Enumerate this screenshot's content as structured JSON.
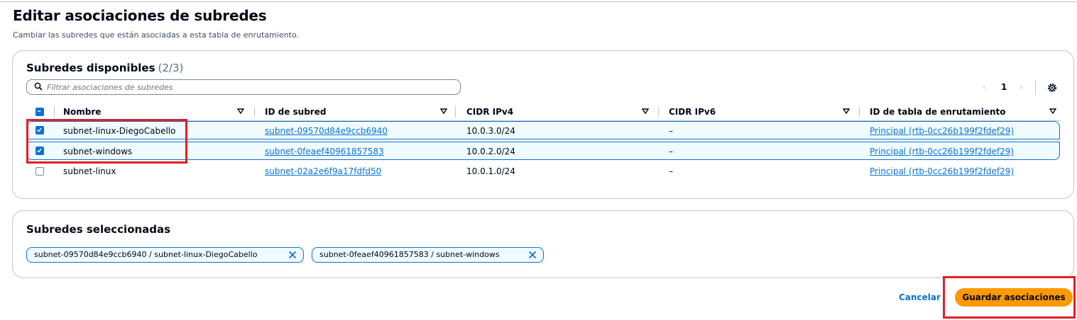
{
  "page": {
    "title": "Editar asociaciones de subredes",
    "description": "Cambiar las subredes que están asociadas a esta tabla de enrutamiento."
  },
  "available": {
    "title": "Subredes disponibles",
    "count": "(2/3)",
    "filter_placeholder": "Filtrar asociaciones de subredes",
    "page_number": "1",
    "columns": [
      "Nombre",
      "ID de subred",
      "CIDR IPv4",
      "CIDR IPv6",
      "ID de tabla de enrutamiento"
    ],
    "rows": [
      {
        "name": "subnet-linux-DiegoCabello",
        "subnet_id": "subnet-09570d84e9ccb6940",
        "ipv4": "10.0.3.0/24",
        "ipv6": "–",
        "route_table": "Principal (rtb-0cc26b199f2fdef29)",
        "checked": true
      },
      {
        "name": "subnet-windows",
        "subnet_id": "subnet-0feaef40961857583",
        "ipv4": "10.0.2.0/24",
        "ipv6": "–",
        "route_table": "Principal (rtb-0cc26b199f2fdef29)",
        "checked": true
      },
      {
        "name": "subnet-linux",
        "subnet_id": "subnet-02a2e6f9a17fdfd50",
        "ipv4": "10.0.1.0/24",
        "ipv6": "–",
        "route_table": "Principal (rtb-0cc26b199f2fdef29)",
        "checked": false
      }
    ]
  },
  "selected": {
    "title": "Subredes seleccionadas",
    "tokens": [
      "subnet-09570d84e9ccb6940 / subnet-linux-DiegoCabello",
      "subnet-0feaef40961857583 / subnet-windows"
    ]
  },
  "actions": {
    "cancel_label": "Cancelar",
    "save_label": "Guardar asociaciones"
  },
  "colors": {
    "accent": "#0972d3",
    "primary_button": "#ff9900",
    "highlight_box": "#e51e25"
  },
  "icons": [
    "search-icon",
    "chevron-left-icon",
    "chevron-right-icon",
    "gear-icon",
    "sort-icon",
    "close-icon"
  ]
}
